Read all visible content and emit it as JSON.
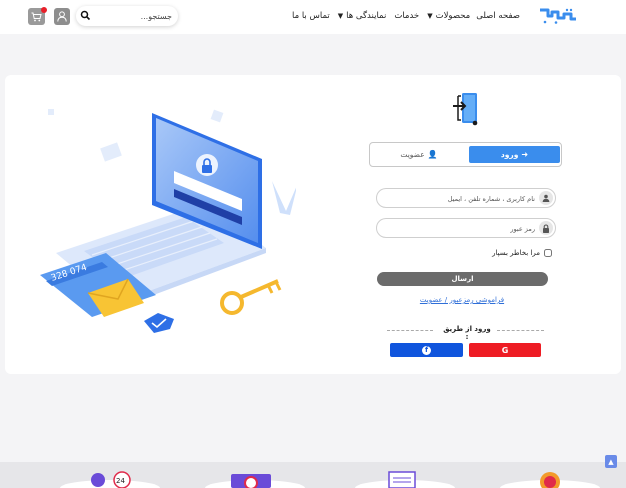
{
  "header": {
    "search_placeholder": "جستجو...",
    "nav": [
      {
        "label": "صفحه اصلی",
        "has_dropdown": false
      },
      {
        "label": "محصولات",
        "has_dropdown": true
      },
      {
        "label": "خدمات",
        "has_dropdown": false
      },
      {
        "label": "نمایندگی ها",
        "has_dropdown": true
      },
      {
        "label": "تماس با ما",
        "has_dropdown": false
      }
    ],
    "cart_icon": "cart-icon",
    "user_icon": "user-icon",
    "cart_badge_color": "#e8202a"
  },
  "login": {
    "tab_login": "ورود",
    "tab_join": "عضویت",
    "username_placeholder": "نام کاربری ، شماره تلفن ، ایمیل",
    "password_placeholder": "رمز عبور",
    "remember_label": "مرا بخاطر بسپار",
    "submit_label": "ارسال",
    "forgot_link": "فراموشی رمزعبور / عضویت",
    "via_label": "ورود از طریق :",
    "google_label": "G",
    "facebook_label": "f",
    "accent_color": "#3a8ded",
    "google_color": "#ee1c24",
    "facebook_color": "#1055dd"
  },
  "illustration": {
    "card_number": "328 074"
  },
  "bottom": {
    "badge_24": "24"
  }
}
